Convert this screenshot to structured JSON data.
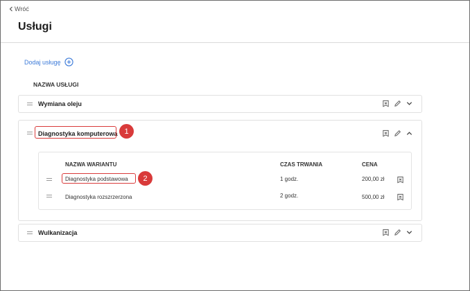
{
  "nav": {
    "back_label": "Wróć"
  },
  "page": {
    "title": "Usługi"
  },
  "toolbar": {
    "add_label": "Dodaj usługę"
  },
  "table": {
    "column_header": "NAZWA USŁUGI"
  },
  "services": [
    {
      "name": "Wymiana oleju",
      "expanded": false
    },
    {
      "name": "Diagnostyka komputerowa",
      "expanded": true,
      "variant_headers": {
        "name": "NAZWA WARIANTU",
        "duration": "CZAS TRWANIA",
        "price": "CENA"
      },
      "variants": [
        {
          "name": "Diagnostyka podstawowa",
          "duration": "1 godz.",
          "price": "200,00 zł"
        },
        {
          "name": "Diagnostyka rozszrzerzona",
          "duration": "2 godz.",
          "price": "500,00 zł"
        }
      ]
    },
    {
      "name": "Wulkanizacja",
      "expanded": false
    }
  ],
  "markers": [
    "1",
    "2"
  ],
  "colors": {
    "accent": "#3d7bd9",
    "callout": "#d93a3a"
  },
  "icons": [
    "chevron-left-icon",
    "plus-circle-icon",
    "drag-handle-icon",
    "delete-icon",
    "edit-pencil-icon",
    "chevron-down-icon",
    "chevron-up-icon"
  ]
}
